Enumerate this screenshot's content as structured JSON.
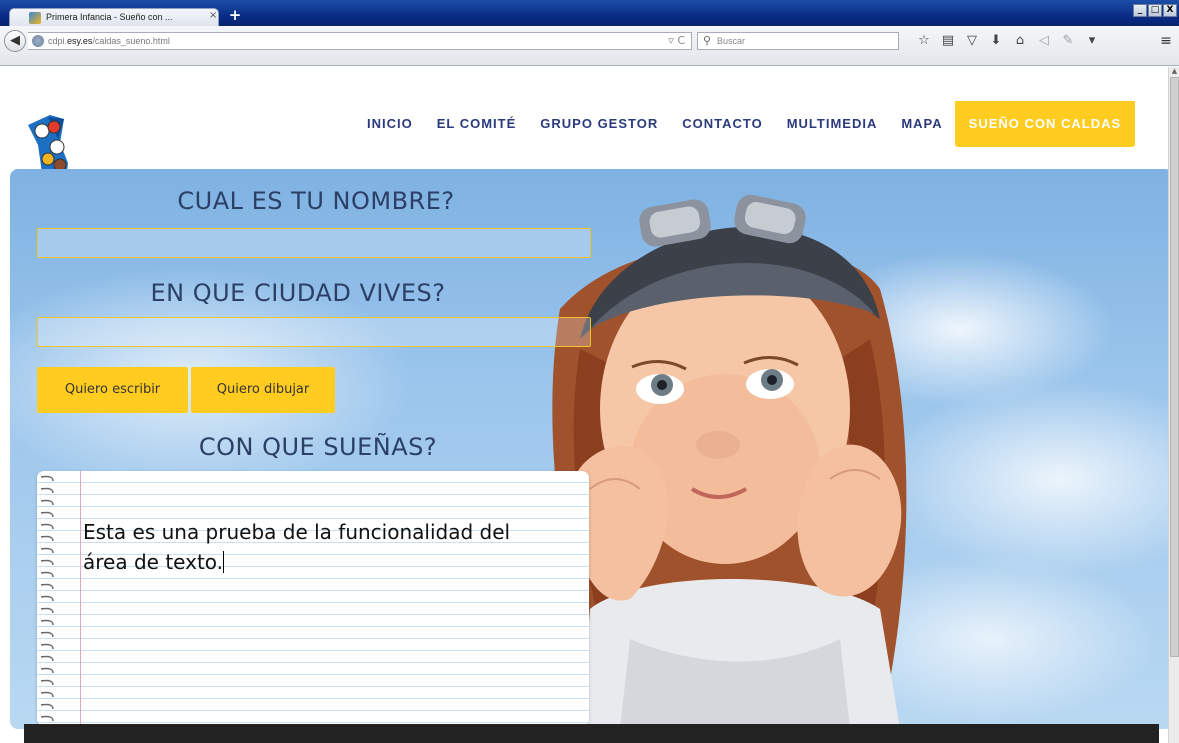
{
  "browser": {
    "tab_title": "Primera Infancia - Sueño con ...",
    "tab_close": "×",
    "new_tab": "+",
    "url_prefix": "cdpi.",
    "url_domain": "esy.es",
    "url_path": "/caldas_sueno.html",
    "search_placeholder": "Buscar",
    "window_buttons": [
      "_",
      "□",
      "X"
    ],
    "toolbar_icons": [
      "star-icon",
      "reading-list-icon",
      "pocket-icon",
      "download-icon",
      "home-icon",
      "send-icon",
      "extension-icon",
      "dropdown-icon"
    ]
  },
  "site": {
    "nav": {
      "items": [
        {
          "label": "INICIO"
        },
        {
          "label": "EL COMITÉ"
        },
        {
          "label": "GRUPO GESTOR"
        },
        {
          "label": "CONTACTO"
        },
        {
          "label": "MULTIMEDIA"
        },
        {
          "label": "MAPA"
        },
        {
          "label": "SUEÑO CON CALDAS"
        }
      ],
      "active_index": 6
    },
    "form": {
      "name_label": "CUAL ES TU NOMBRE?",
      "name_value": "",
      "city_label": "EN QUE CIUDAD VIVES?",
      "city_value": "",
      "write_button": "Quiero escribir",
      "draw_button": "Quiero dibujar",
      "dream_label": "CON QUE SUEÑAS?",
      "dream_text": "Esta es una prueba de la funcionalidad del área de texto."
    },
    "colors": {
      "accent": "#ffcc1f",
      "nav_text": "#2b3a7d",
      "field_border": "#f2c427"
    }
  }
}
